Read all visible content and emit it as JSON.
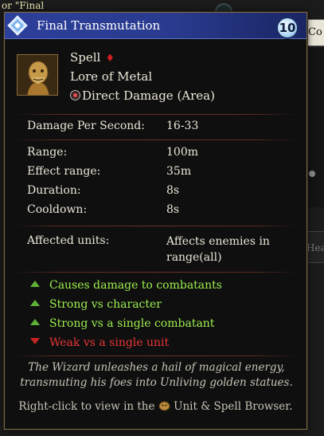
{
  "background": {
    "topleft_text": "or \"Final",
    "right_button_label": "Co",
    "right_fragment_text": "Heahun"
  },
  "tooltip": {
    "title": "Final Transmutation",
    "cost": "10",
    "title_icon": "spell-diamond-icon",
    "portrait_icon": "golden-statue-portrait-icon",
    "spell_type": "Spell",
    "lore": "Lore of Metal",
    "damage_type_icon": "direct-damage-icon",
    "damage_type": "Direct Damage (Area)",
    "stats": {
      "dps_label": "Damage Per Second:",
      "dps_value": "16-33",
      "range_label": "Range:",
      "range_value": "100m",
      "effect_range_label": "Effect range:",
      "effect_range_value": "35m",
      "duration_label": "Duration:",
      "duration_value": "8s",
      "cooldown_label": "Cooldown:",
      "cooldown_value": "8s",
      "affected_label": "Affected units:",
      "affected_value": "Affects enemies in range(all)"
    },
    "traits": [
      {
        "text": "Causes damage to combatants",
        "polarity": "positive"
      },
      {
        "text": "Strong vs character",
        "polarity": "positive"
      },
      {
        "text": "Strong vs a single combatant",
        "polarity": "positive"
      },
      {
        "text": "Weak vs a single unit",
        "polarity": "negative"
      }
    ],
    "flavor_text": "The Wizard unleashes a hail of magical energy, transmuting his foes into Unliving golden statues.",
    "hint_prefix": "Right-click to view in the",
    "hint_icon": "unit-browser-icon",
    "hint_suffix": "Unit & Spell Browser."
  },
  "colors": {
    "titlebar": "#2c3f9a",
    "positive": "#9ef04e",
    "negative": "#e83535",
    "border": "#7a6a45"
  }
}
